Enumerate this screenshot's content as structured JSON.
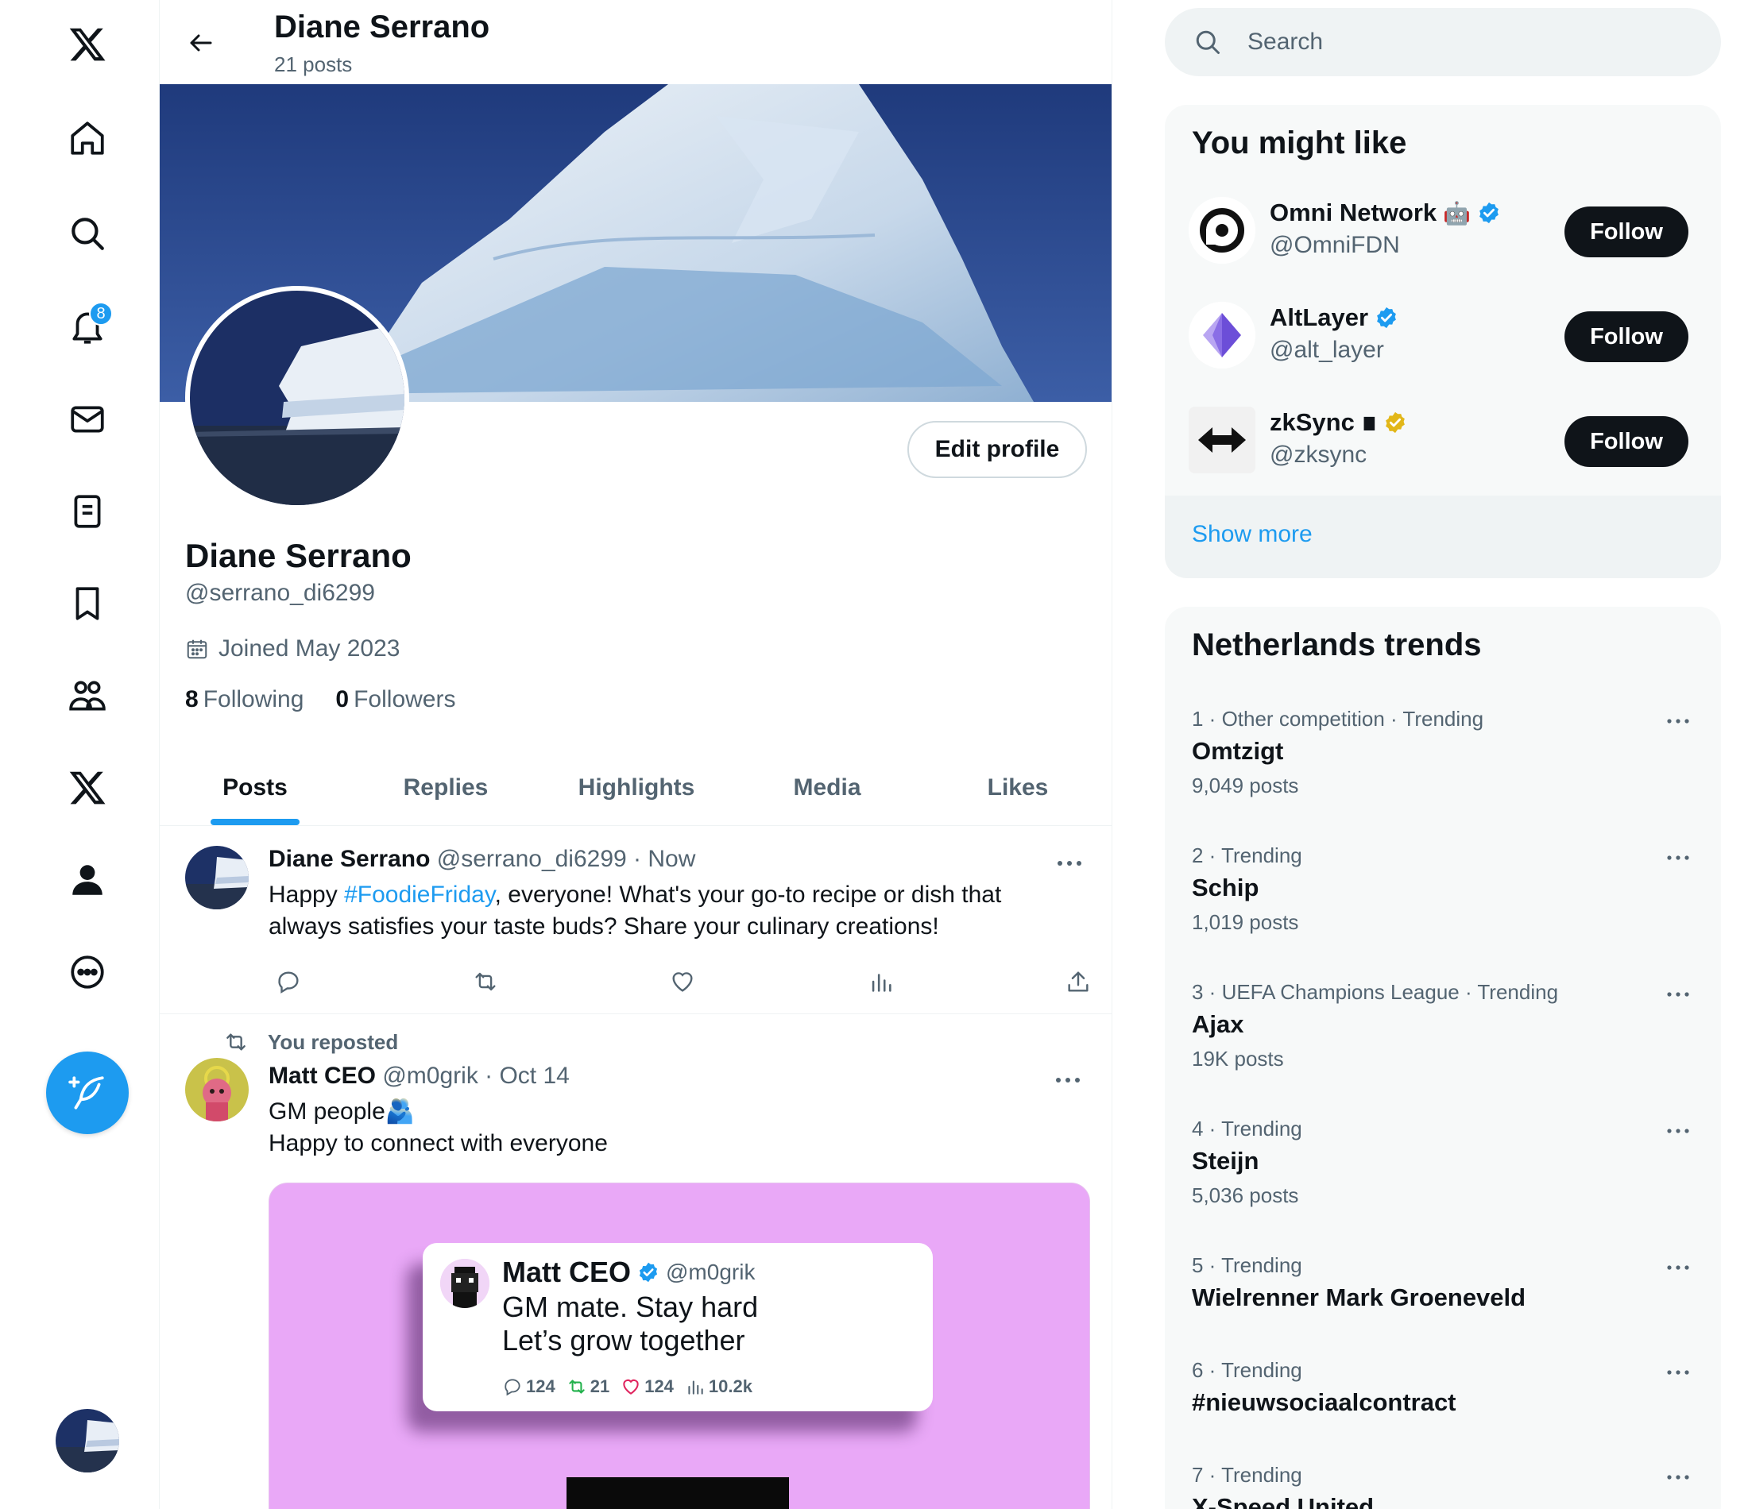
{
  "nav": {
    "notifications_badge": "8"
  },
  "profile": {
    "name": "Diane Serrano",
    "post_count": "21 posts",
    "handle": "@serrano_di6299",
    "joined": "Joined May 2023",
    "following_count": "8",
    "following_label": "Following",
    "followers_count": "0",
    "followers_label": "Followers",
    "edit_label": "Edit profile"
  },
  "tabs": [
    "Posts",
    "Replies",
    "Highlights",
    "Media",
    "Likes"
  ],
  "posts": [
    {
      "author": "Diane Serrano",
      "handle_time": "@serrano_di6299 · Now",
      "text_before": "Happy ",
      "hashtag": "#FoodieFriday",
      "text_after": ", everyone! What's your go-to recipe or dish that always satisfies your taste buds? Share your culinary creations!"
    },
    {
      "repost_label": "You reposted",
      "author": "Matt CEO",
      "handle_time": "@m0grik · Oct 14",
      "line1": "GM people🫂",
      "line2": "Happy to connect with everyone",
      "quote": {
        "name": "Matt CEO",
        "handle": "@m0grik",
        "line1": "GM mate. Stay hard",
        "line2": "Let’s grow together",
        "replies": "124",
        "reposts": "21",
        "likes": "124",
        "views": "10.2k"
      }
    }
  ],
  "search": {
    "placeholder": "Search"
  },
  "suggestions": {
    "title": "You might like",
    "items": [
      {
        "name": "Omni Network",
        "handle": "@OmniFDN",
        "button": "Follow"
      },
      {
        "name": "AltLayer",
        "handle": "@alt_layer",
        "button": "Follow"
      },
      {
        "name": "zkSync ∎",
        "handle": "@zksync",
        "button": "Follow"
      }
    ],
    "show_more": "Show more"
  },
  "trends": {
    "title": "Netherlands trends",
    "items": [
      {
        "meta": "1 · Other competition · Trending",
        "name": "Omtzigt",
        "count": "9,049 posts"
      },
      {
        "meta": "2 · Trending",
        "name": "Schip",
        "count": "1,019 posts"
      },
      {
        "meta": "3 · UEFA Champions League · Trending",
        "name": "Ajax",
        "count": "19K posts"
      },
      {
        "meta": "4 · Trending",
        "name": "Steijn",
        "count": "5,036 posts"
      },
      {
        "meta": "5 · Trending",
        "name": "Wielrenner Mark Groeneveld",
        "count": ""
      },
      {
        "meta": "6 · Trending",
        "name": "#nieuwsociaalcontract",
        "count": ""
      },
      {
        "meta": "7 · Trending",
        "name": "X-Speed United",
        "count": ""
      }
    ]
  },
  "colors": {
    "accent": "#1d9bf0",
    "text": "#0f1419",
    "muted": "#536471",
    "media_bg": "#e9a8f7"
  }
}
